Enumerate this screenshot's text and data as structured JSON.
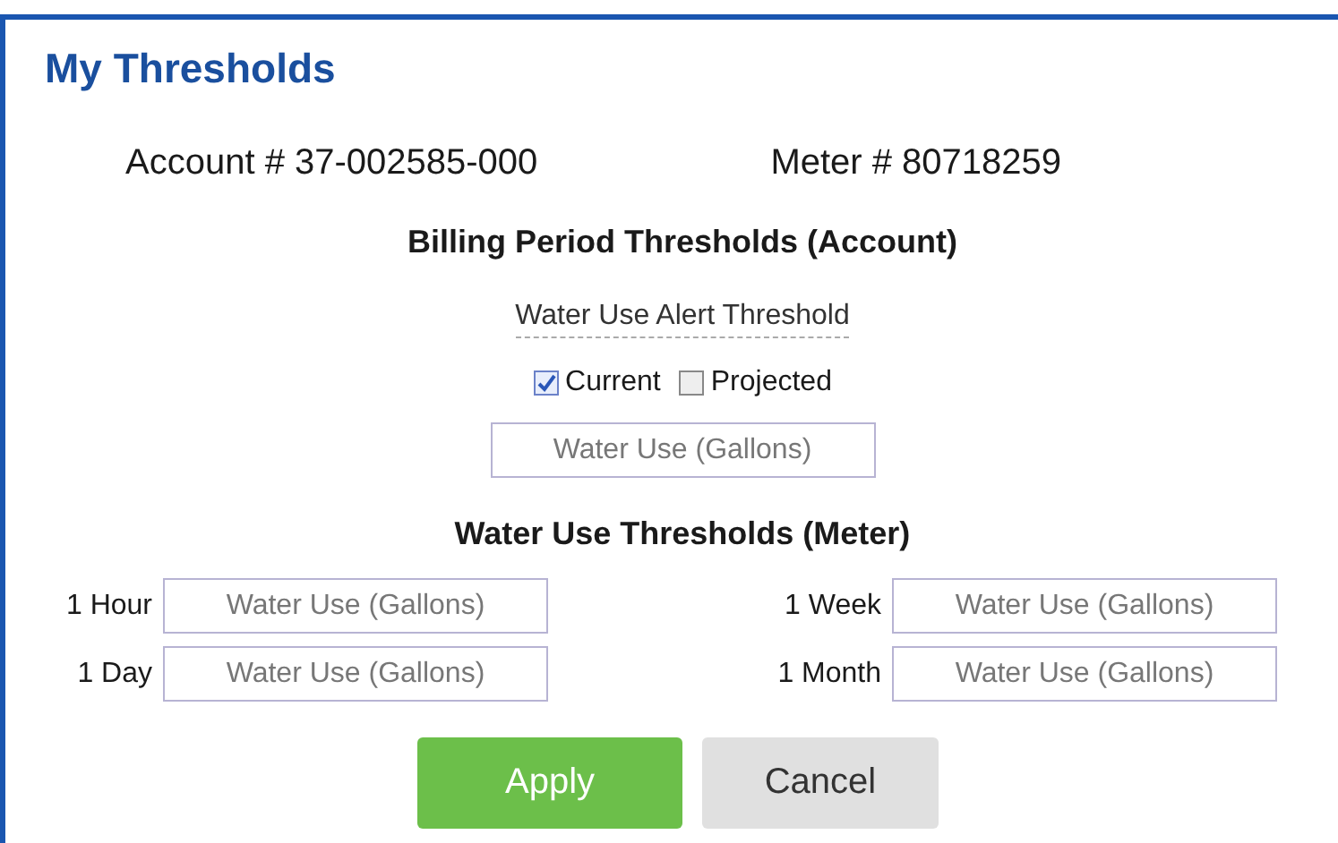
{
  "dialog": {
    "title": "My Thresholds",
    "account": "Account # 37-002585-000",
    "meter": "Meter # 80718259",
    "billing_heading": "Billing Period Thresholds (Account)",
    "alert_label": "Water Use Alert Threshold",
    "options": [
      {
        "label": "Current",
        "checked": true
      },
      {
        "label": "Projected",
        "checked": false
      }
    ],
    "billing_input": {
      "placeholder": "Water Use (Gallons)"
    },
    "meter_heading": "Water Use Thresholds (Meter)",
    "meter_fields": [
      {
        "label": "1 Hour",
        "placeholder": "Water Use (Gallons)"
      },
      {
        "label": "1 Week",
        "placeholder": "Water Use (Gallons)"
      },
      {
        "label": "1 Day",
        "placeholder": "Water Use (Gallons)"
      },
      {
        "label": "1 Month",
        "placeholder": "Water Use (Gallons)"
      }
    ],
    "buttons": [
      {
        "label": "Apply",
        "kind": "primary"
      },
      {
        "label": "Cancel",
        "kind": "secondary"
      }
    ]
  }
}
